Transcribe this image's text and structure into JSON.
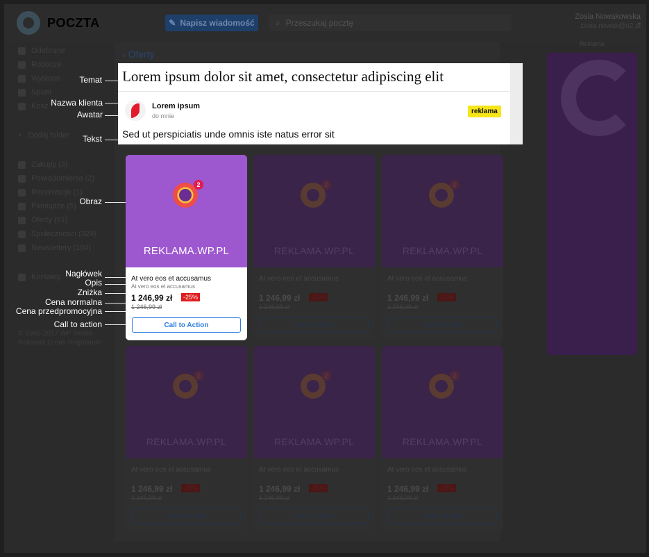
{
  "app": {
    "logo_text": "POCZTA"
  },
  "toolbar": {
    "compose_label": "Napisz wiadomość",
    "search_placeholder": "Przeszukaj pocztę"
  },
  "user": {
    "name": "Zosia Nowakowska",
    "email": "zosia.nowak@o2.pl"
  },
  "sidebar": {
    "folders": [
      {
        "label": "Odebrane",
        "icon": "inbox-icon"
      },
      {
        "label": "Robocze",
        "icon": "draft-icon"
      },
      {
        "label": "Wysłane",
        "icon": "send-icon"
      },
      {
        "label": "Spam",
        "icon": "spam-icon"
      },
      {
        "label": "Kosz",
        "icon": "trash-icon"
      }
    ],
    "add_folder": "Dodaj folder",
    "categories": [
      {
        "label": "Zakupy (3)",
        "icon": "cart-icon"
      },
      {
        "label": "Powiadomienia (2)",
        "icon": "bell-icon"
      },
      {
        "label": "Rezerwacje (1)",
        "icon": "calendar-icon"
      },
      {
        "label": "Pieniądze (5)",
        "icon": "money-icon"
      },
      {
        "label": "Oferty (91)",
        "icon": "tag-icon"
      },
      {
        "label": "Społeczności (329)",
        "icon": "people-icon"
      },
      {
        "label": "Newslettery (104)",
        "icon": "newsletter-icon"
      }
    ],
    "contacts": "Kontakty",
    "footer_1": "© 1995-2017 WP Media",
    "footer_2": "Reklama  O nas  Regulamin"
  },
  "ad_column": {
    "label": "Reklama"
  },
  "back_link": "Oferty",
  "message": {
    "subject": "Lorem ipsum dolor sit amet, consectetur adipiscing elit",
    "sender": "Lorem ipsum",
    "recipient": "do mnie",
    "badge": "reklama",
    "preview": "Sed ut perspiciatis unde omnis iste natus error sit"
  },
  "cards": [
    {
      "brand": "REKLAMA.WP.PL",
      "headline": "At vero eos et accusamus",
      "description": "At vero eos et accusamus",
      "price": "1 246,99 zł",
      "discount": "-25%",
      "old_price": "1 246,99 zł",
      "cta": "Call to Action",
      "badge": "2"
    },
    {
      "brand": "REKLAMA.WP.PL",
      "headline": "At vero eos et accusamus",
      "description": "",
      "price": "1 246,99 zł",
      "discount": "-25%",
      "old_price": "1 246,99 zł",
      "cta": "Call to Action",
      "badge": "2"
    },
    {
      "brand": "REKLAMA.WP.PL",
      "headline": "At vero eos et accusamus",
      "description": "",
      "price": "1 246,99 zł",
      "discount": "-25%",
      "old_price": "1 246,99 zł",
      "cta": "Call to Action",
      "badge": "2"
    },
    {
      "brand": "REKLAMA.WP.PL",
      "headline": "At vero eos et accusamus",
      "description": "",
      "price": "1 246,99 zł",
      "discount": "-25%",
      "old_price": "1 246,99 zł",
      "cta": "Call to Action",
      "badge": "2"
    },
    {
      "brand": "REKLAMA.WP.PL",
      "headline": "At vero eos et accusamus",
      "description": "",
      "price": "1 246,99 zł",
      "discount": "-25%",
      "old_price": "1 246,99 zł",
      "cta": "Call to Action",
      "badge": "2"
    },
    {
      "brand": "REKLAMA.WP.PL",
      "headline": "At vero eos et accusamus",
      "description": "",
      "price": "1 246,99 zł",
      "discount": "-25%",
      "old_price": "1 246,99 zł",
      "cta": "Call to Action",
      "badge": "2"
    }
  ],
  "annotations": {
    "temat": "Temat",
    "nazwa_klienta": "Nazwa klienta",
    "awatar": "Awatar",
    "tekst": "Tekst",
    "obraz": "Obraz",
    "naglowek": "Nagłówek",
    "opis": "Opis",
    "znizka": "Zniżka",
    "cena_normalna": "Cena normalna",
    "cena_przedpromocyjna": "Cena przedpromocyjna",
    "call_to_action": "Call to action"
  },
  "colors": {
    "accent": "#2f7de1",
    "ad_purple": "#9d57cf",
    "badge_yellow": "#f6e617",
    "discount_red": "#e01b1b"
  }
}
